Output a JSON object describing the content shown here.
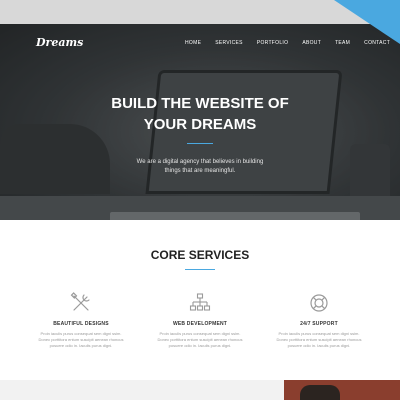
{
  "nav": {
    "logo": "Dreams",
    "items": [
      "HOME",
      "SERVICES",
      "PORTFOLIO",
      "ABOUT",
      "TEAM",
      "CONTACT"
    ]
  },
  "hero": {
    "title_line1": "BUILD THE WEBSITE OF",
    "title_line2": "YOUR DREAMS",
    "subtitle_line1": "We are a digital agency that believes in building",
    "subtitle_line2": "things that are meaningful."
  },
  "services": {
    "title": "CORE SERVICES",
    "items": [
      {
        "icon": "tools-icon",
        "title": "BEAUTIFUL DESIGNS",
        "desc": [
          "Proin iaculis purus consequat sem digni ssim.",
          "Donec porttitora entum suscipit aenean rhoncus",
          "posuere odio in. Iaculis purus digni."
        ]
      },
      {
        "icon": "sitemap-icon",
        "title": "WEB DEVELOPMENT",
        "desc": [
          "Proin iaculis purus consequat sem digni ssim.",
          "Donec porttitora entum suscipit aenean rhoncus",
          "posuere odio in. Iaculis purus digni."
        ]
      },
      {
        "icon": "lifebuoy-icon",
        "title": "24/7 SUPPORT",
        "desc": [
          "Proin iaculis purus consequat sem digni ssim.",
          "Donec porttitora entum suscipit aenean rhoncus",
          "posuere odio in. Iaculis purus digni."
        ]
      }
    ]
  },
  "colors": {
    "accent": "#4aa8e0",
    "heading": "#222222"
  }
}
